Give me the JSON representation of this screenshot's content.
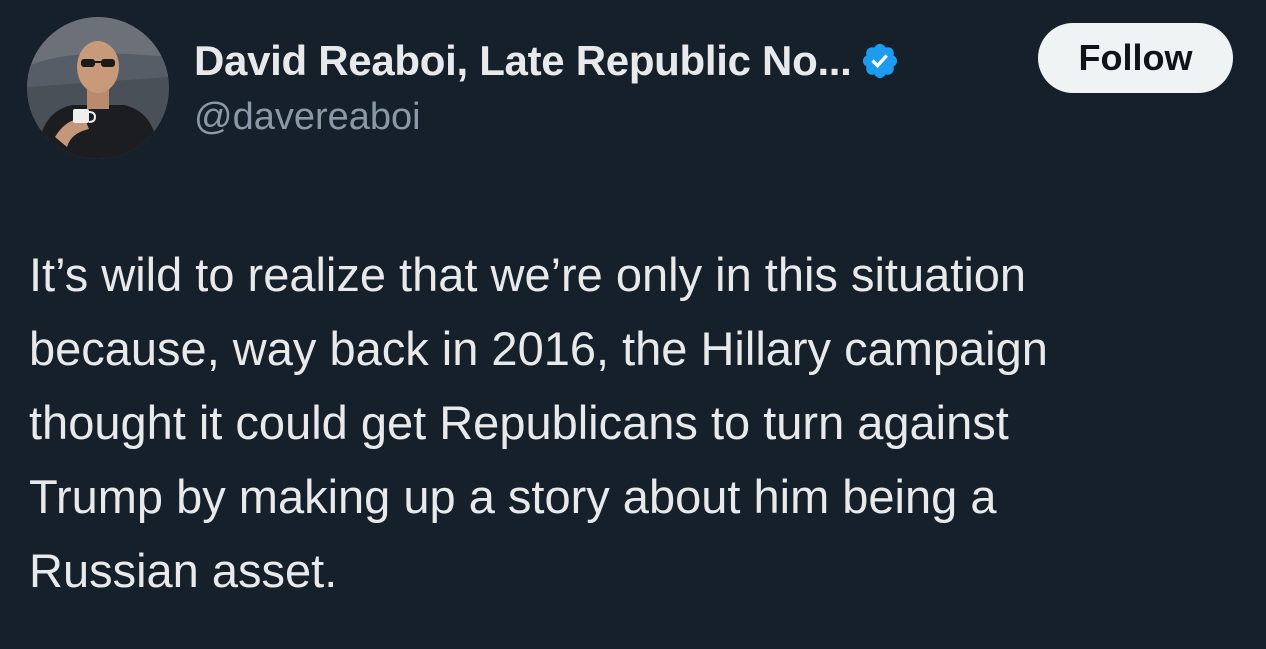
{
  "author": {
    "display_name": "David Reaboi, Late Republic No...",
    "handle": "@davereaboi",
    "verified_icon": "verified-badge-icon",
    "avatar": "profile-photo"
  },
  "actions": {
    "follow_label": "Follow"
  },
  "tweet": {
    "text_lines": [
      "It’s wild to realize that we’re only in this situation",
      "because, way back in 2016, the Hillary campaign",
      "thought it could get Republicans to turn against",
      "Trump by making up a story about him being a",
      "Russian asset."
    ]
  },
  "colors": {
    "background": "#15202b",
    "text": "#e7e9ea",
    "secondary_text": "#8b98a5",
    "verified_blue": "#1d9bf0",
    "follow_button_bg": "#eff3f4"
  }
}
